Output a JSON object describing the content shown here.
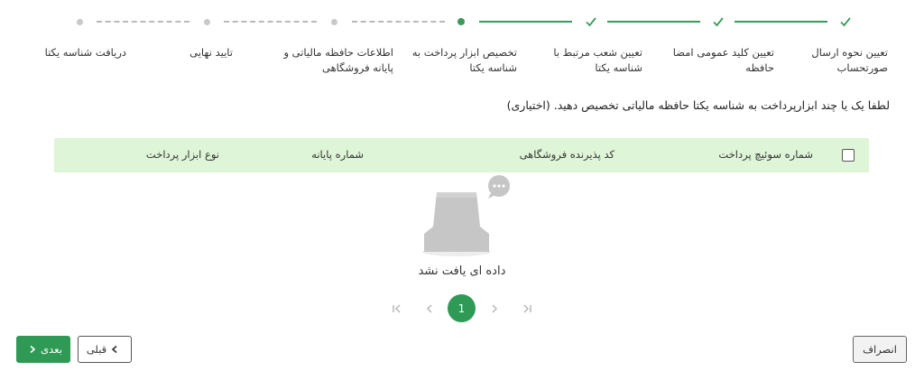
{
  "steps": [
    {
      "label": "تعیین نحوه ارسال صورتحساب",
      "status": "done"
    },
    {
      "label": "تعیین کلید عمومی امضا حافظه",
      "status": "done"
    },
    {
      "label": "تعیین شعب مرتبط با شناسه یکتا",
      "status": "done"
    },
    {
      "label": "تخصیص ابزار پرداخت به شناسه یکتا",
      "status": "current"
    },
    {
      "label": "اطلاعات حافظه مالیاتی و پایانه فروشگاهی",
      "status": "todo"
    },
    {
      "label": "تایید نهایی",
      "status": "todo"
    },
    {
      "label": "دریافت شناسه یکتا",
      "status": "todo"
    }
  ],
  "instruction": "لطفا یک یا چند ابزارپرداخت به شناسه یکتا حافظه مالیاتی تخصیص دهید. (اختیاری)",
  "table": {
    "columns": [
      "شماره سوئیچ پرداخت",
      "کد پذیرنده فروشگاهی",
      "شماره پایانه",
      "نوع ابزار پرداخت"
    ],
    "empty_text": "داده ای یافت نشد"
  },
  "pagination": {
    "current": "1"
  },
  "buttons": {
    "next": "بعدی",
    "prev": "قبلی",
    "cancel": "انصراف"
  },
  "colors": {
    "accent": "#2f9a55",
    "header_bg": "#dff5d7"
  }
}
